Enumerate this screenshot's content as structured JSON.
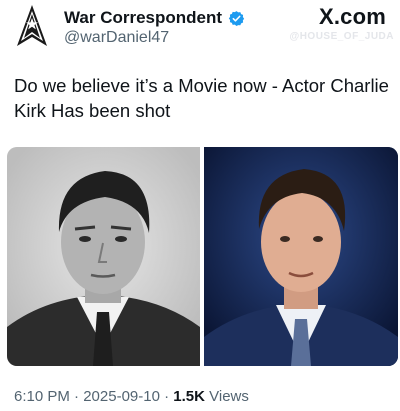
{
  "author": {
    "display_name": "War Correspondent",
    "handle": "@warDaniel47",
    "verified": true
  },
  "brand": {
    "logo_text": "X.com",
    "watermark": "@HOUSE_OF_JUDA"
  },
  "tweet": {
    "text": "Do we believe it’s a Movie now - Actor Charlie Kirk Has been shot"
  },
  "media": {
    "images": [
      {
        "style": "black-and-white portrait"
      },
      {
        "style": "color portrait, blue background"
      }
    ]
  },
  "meta": {
    "time": "6:10 PM",
    "separator": " · ",
    "date": "2025-09-10",
    "views_count": "1.5K",
    "views_label": " Views"
  },
  "colors": {
    "verified": "#1d9bf0",
    "text": "#0f1419",
    "secondary": "#536471"
  },
  "icons": {
    "avatar": "arrowhead-logo-icon",
    "verified": "verified-badge-icon"
  }
}
